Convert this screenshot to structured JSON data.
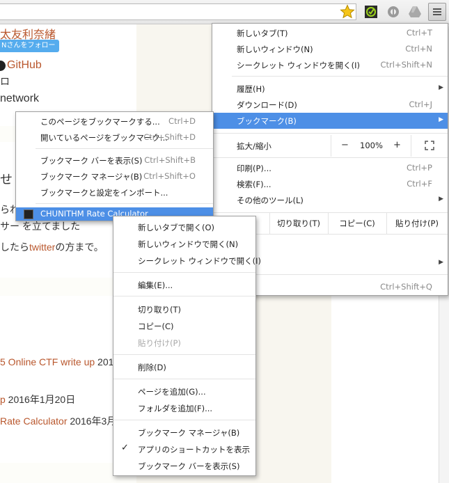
{
  "page": {
    "author": "太友利奈緒",
    "follow_label": "Nさんをフォロー",
    "github_label": "GitHub",
    "kana": "ロ",
    "network": "network",
    "heading_char": "せ",
    "text_ra": "られ",
    "text_sa": "サー  を立てました",
    "text_twitter_pre": "したら",
    "text_twitter_link": "twitter",
    "text_twitter_post": "の方まで。",
    "post1_link": "5 Online CTF write up",
    "post1_date": " 201",
    "post2_link": "p",
    "post2_date": " 2016年1月20日",
    "post3_link": "Rate Calculator",
    "post3_date": " 2016年3月"
  },
  "chrome_menu": {
    "new_tab": {
      "label": "新しいタブ(T)",
      "shortcut": "Ctrl+T"
    },
    "new_window": {
      "label": "新しいウィンドウ(N)",
      "shortcut": "Ctrl+N"
    },
    "incognito": {
      "label": "シークレット ウィンドウを開く(I)",
      "shortcut": "Ctrl+Shift+N"
    },
    "history": {
      "label": "履歴(H)"
    },
    "downloads": {
      "label": "ダウンロード(D)",
      "shortcut": "Ctrl+J"
    },
    "bookmarks": {
      "label": "ブックマーク(B)"
    },
    "zoom_label": "拡大/縮小",
    "zoom_minus": "−",
    "zoom_value": "100%",
    "zoom_plus": "+",
    "print": {
      "label": "印刷(P)...",
      "shortcut": "Ctrl+P"
    },
    "find": {
      "label": "検索(F)...",
      "shortcut": "Ctrl+F"
    },
    "more_tools": {
      "label": "その他のツール(L)"
    },
    "cut": "切り取り(T)",
    "copy": "コピー(C)",
    "paste": "貼り付け(P)",
    "settings_tail": "S)",
    "help_tail": "H)",
    "exit_tail": "X)",
    "exit_shortcut": "Ctrl+Shift+Q"
  },
  "bookmark_submenu": {
    "bookmark_page": {
      "label": "このページをブックマークする...",
      "shortcut": "Ctrl+D"
    },
    "bookmark_open": {
      "label": "開いているページをブックマーク...",
      "shortcut": "Ctrl+Shift+D"
    },
    "show_bar": {
      "label": "ブックマーク バーを表示(S)",
      "shortcut": "Ctrl+Shift+B"
    },
    "manager": {
      "label": "ブックマーク マネージャ(B)",
      "shortcut": "Ctrl+Shift+O"
    },
    "import": {
      "label": "ブックマークと設定をインポート..."
    },
    "item": {
      "label": "CHUNITHM Rate Calculator"
    }
  },
  "context_menu": {
    "open_new_tab": "新しいタブで開く(O)",
    "open_new_window": "新しいウィンドウで開く(N)",
    "open_incognito": "シークレット ウィンドウで開く(I)",
    "edit": "編集(E)...",
    "cut": "切り取り(T)",
    "copy": "コピー(C)",
    "paste": "貼り付け(P)",
    "delete": "削除(D)",
    "add_page": "ページを追加(G)...",
    "add_folder": "フォルダを追加(F)...",
    "bookmark_manager": "ブックマーク マネージャ(B)",
    "show_app_shortcut": "アプリのショートカットを表示",
    "show_app_shortcut_checked": "✓",
    "show_bookmark_bar": "ブックマーク バーを表示(S)"
  },
  "colors": {
    "highlight": "#4d8fe6",
    "link": "#b9572d",
    "twitter": "#55acee"
  }
}
